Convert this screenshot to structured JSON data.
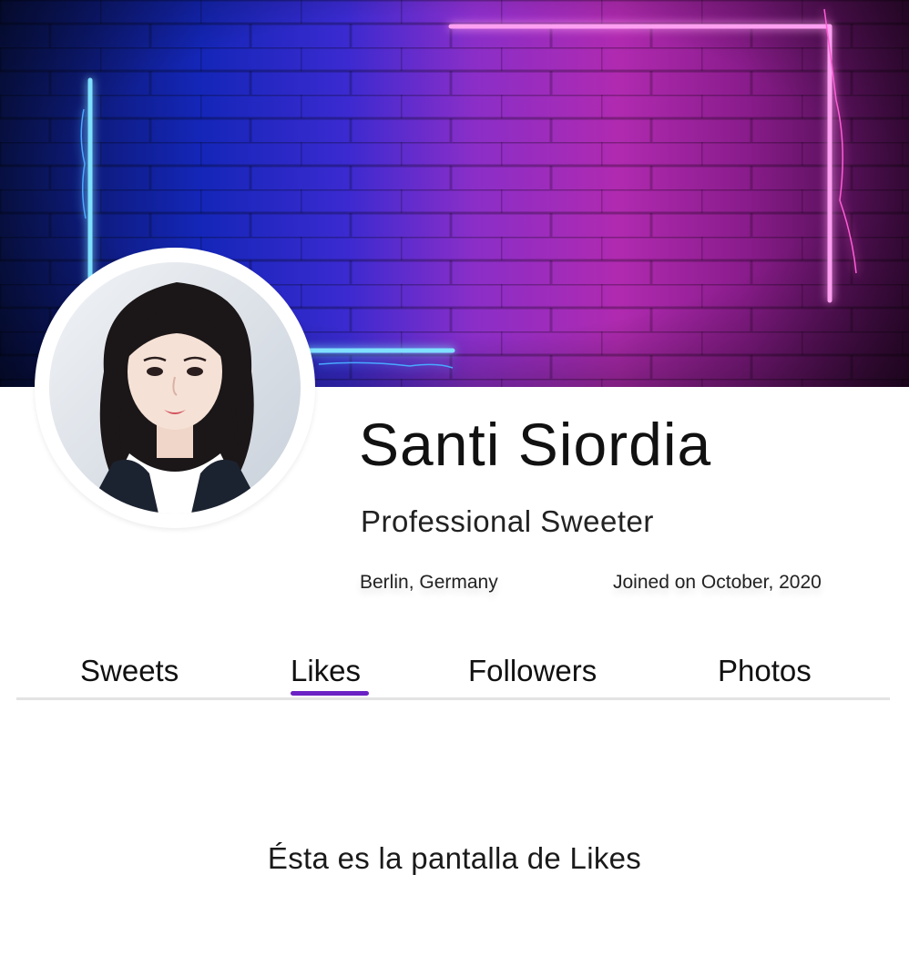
{
  "profile": {
    "name": "Santi Siordia",
    "bio": "Professional Sweeter",
    "location": "Berlin, Germany",
    "joined": "Joined on October, 2020"
  },
  "tabs": [
    {
      "label": "Sweets",
      "active": false
    },
    {
      "label": "Likes",
      "active": true
    },
    {
      "label": "Followers",
      "active": false
    },
    {
      "label": "Photos",
      "active": false
    }
  ],
  "content": {
    "message": "Ésta es la pantalla de Likes"
  },
  "colors": {
    "accent": "#6b22c4",
    "neon_blue": "#5fd0ff",
    "neon_pink": "#ff6ae6"
  },
  "images": {
    "cover": "neon-brick-wall-cover",
    "avatar": "illustrated-portrait-avatar"
  }
}
